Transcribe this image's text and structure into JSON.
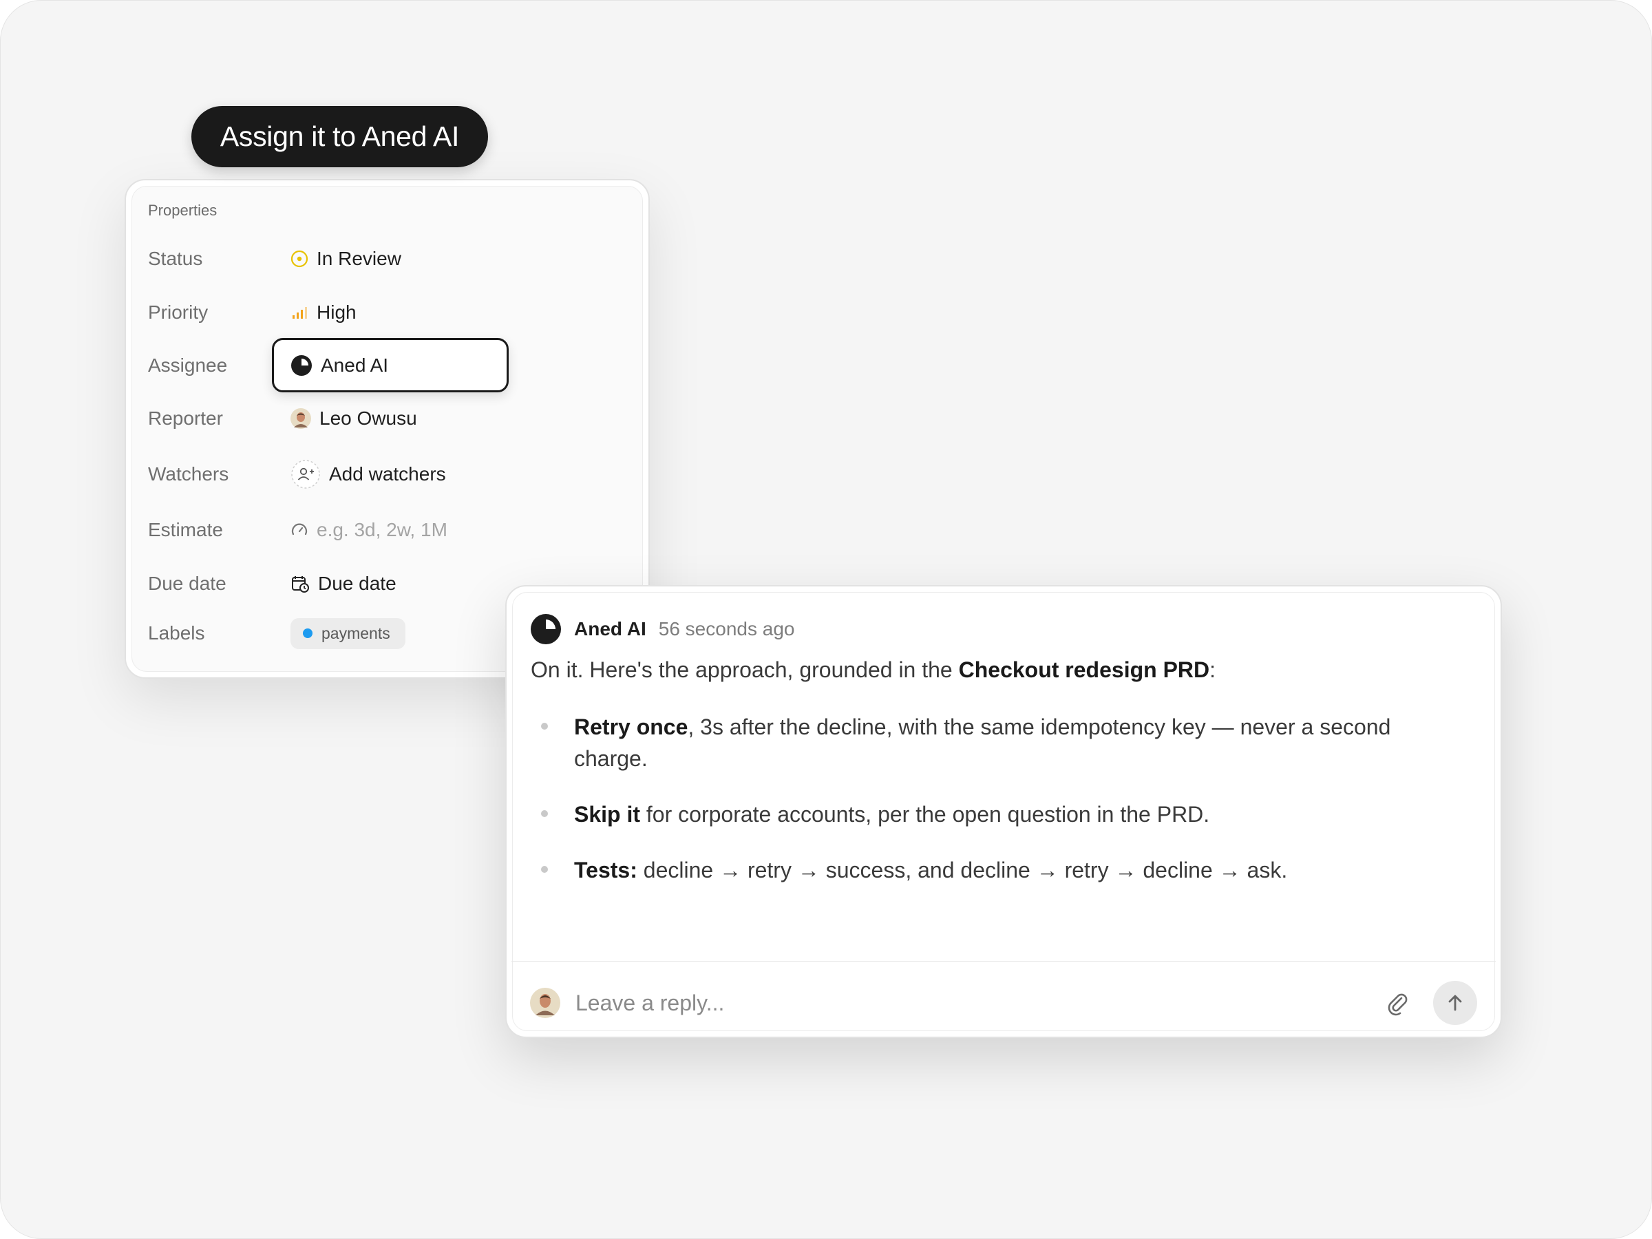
{
  "action_pill": {
    "label": "Assign it to Aned AI"
  },
  "properties": {
    "title": "Properties",
    "rows": {
      "status": {
        "label": "Status",
        "value": "In Review",
        "icon": "in-review-circle-icon",
        "icon_color": "#e8c200"
      },
      "priority": {
        "label": "Priority",
        "value": "High",
        "icon": "signal-bars-icon",
        "icon_color": "#f2a31b"
      },
      "assignee": {
        "label": "Assignee",
        "value": "Aned AI",
        "icon": "aned-ai-logo-icon"
      },
      "reporter": {
        "label": "Reporter",
        "value": "Leo Owusu",
        "icon": "avatar"
      },
      "watchers": {
        "label": "Watchers",
        "value": "Add watchers",
        "icon": "add-user-icon"
      },
      "estimate": {
        "label": "Estimate",
        "placeholder": "e.g. 3d, 2w, 1M",
        "icon": "gauge-icon"
      },
      "due_date": {
        "label": "Due date",
        "value": "Due date",
        "icon": "calendar-clock-icon"
      },
      "labels": {
        "label": "Labels",
        "chips": [
          {
            "text": "payments",
            "color": "#1d9bf0"
          }
        ]
      }
    }
  },
  "comment": {
    "author": "Aned AI",
    "time": "56 seconds ago",
    "intro": {
      "before": "On it. Here's the approach, grounded in the ",
      "bold": "Checkout redesign PRD",
      "after": ":"
    },
    "bullets": [
      {
        "bold": "Retry once",
        "rest": ", 3s after the decline, with the same idempotency key — never a second charge."
      },
      {
        "bold": "Skip it",
        "rest": " for corporate accounts, per the open question in the PRD."
      },
      {
        "bold": "Tests:",
        "rest": " decline → retry → success, and decline → retry → decline → ask."
      }
    ],
    "reply": {
      "placeholder": "Leave a reply..."
    }
  }
}
